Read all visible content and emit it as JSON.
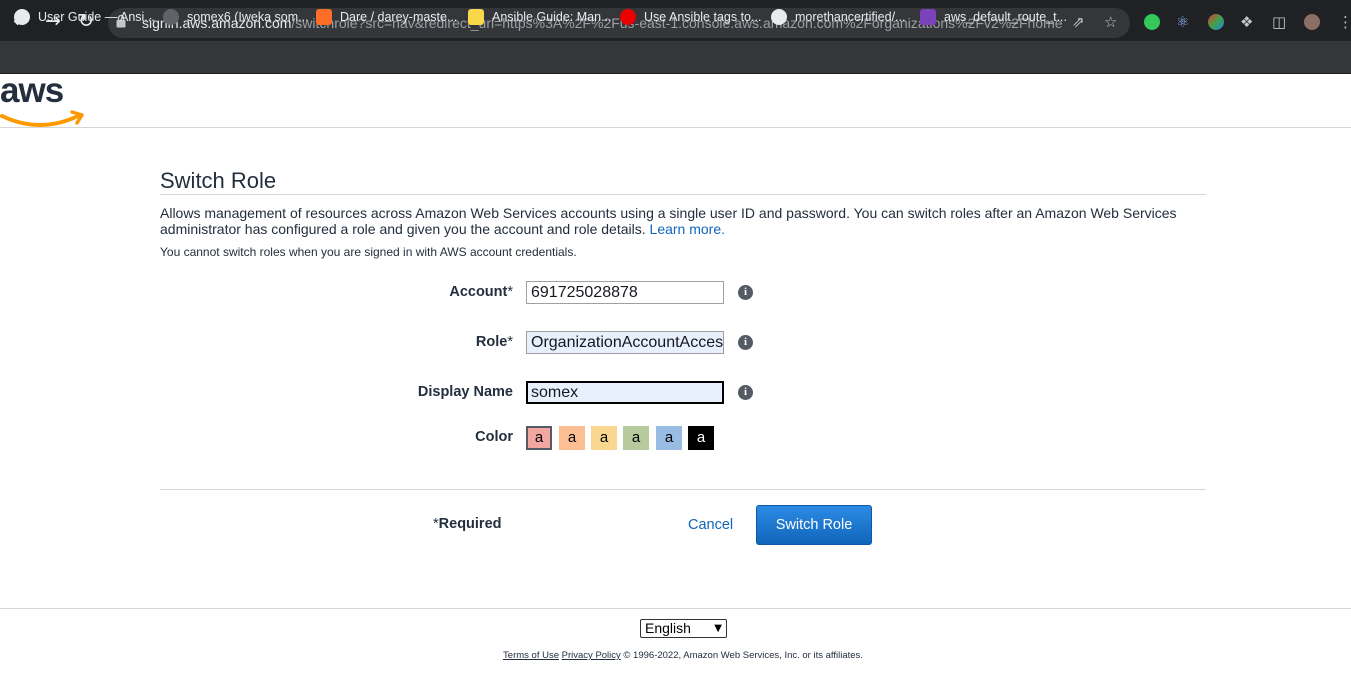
{
  "browser": {
    "url_host": "signin.aws.amazon.com",
    "url_path": "/switchrole?src=nav&redirect_uri=https%3A%2F%2Fus-east-1.console.aws.amazon.com%2Forganizations%2Fv2%2Fhome%...",
    "bookmarks": [
      {
        "label": "User Guide — Ansi...",
        "icon": "globe-icon",
        "color": "#e8eaed"
      },
      {
        "label": "somex6 (Iweka som...",
        "icon": "github-icon",
        "color": "#5f6368"
      },
      {
        "label": "Dare / darey-maste...",
        "icon": "gitlab-icon",
        "color": "#fc6d26"
      },
      {
        "label": "Ansible Guide: Man...",
        "icon": "lightbulb-icon",
        "color": "#f9d74a"
      },
      {
        "label": "Use Ansible tags to...",
        "icon": "redhat-icon",
        "color": "#ee0000"
      },
      {
        "label": "morethancertified/...",
        "icon": "github-icon",
        "color": "#e8eaed"
      },
      {
        "label": "aws_default_route_t...",
        "icon": "terraform-icon",
        "color": "#7b42bc"
      }
    ]
  },
  "page": {
    "title": "Switch Role",
    "description": "Allows management of resources across Amazon Web Services accounts using a single user ID and password. You can switch roles after an Amazon Web Services administrator has configured a role and given you the account and role details.",
    "learn_more": "Learn more.",
    "notice": "You cannot switch roles when you are signed in with AWS account credentials."
  },
  "form": {
    "account_label": "Account",
    "account_value": "691725028878",
    "role_label": "Role",
    "role_value": "OrganizationAccountAccessRole",
    "display_name_label": "Display Name",
    "display_name_value": "somex",
    "color_label": "Color",
    "required_mark": "*",
    "swatches": [
      {
        "letter": "a",
        "color": "#f2a6a0",
        "selected": true
      },
      {
        "letter": "a",
        "color": "#fbbf93",
        "selected": false
      },
      {
        "letter": "a",
        "color": "#fad791",
        "selected": false
      },
      {
        "letter": "a",
        "color": "#b7ca9d",
        "selected": false
      },
      {
        "letter": "a",
        "color": "#99bce3",
        "selected": false
      },
      {
        "letter": "a",
        "color": "#000000",
        "selected": false
      }
    ]
  },
  "actions": {
    "required_note": "Required",
    "cancel": "Cancel",
    "submit": "Switch Role"
  },
  "footer": {
    "language": "English",
    "terms": "Terms of Use",
    "privacy": "Privacy Policy",
    "copyright": "© 1996-2022, Amazon Web Services, Inc. or its affiliates."
  },
  "colors": {
    "link": "#1166bb",
    "primary_button": "#1166bb",
    "aws_orange": "#ff9900"
  }
}
